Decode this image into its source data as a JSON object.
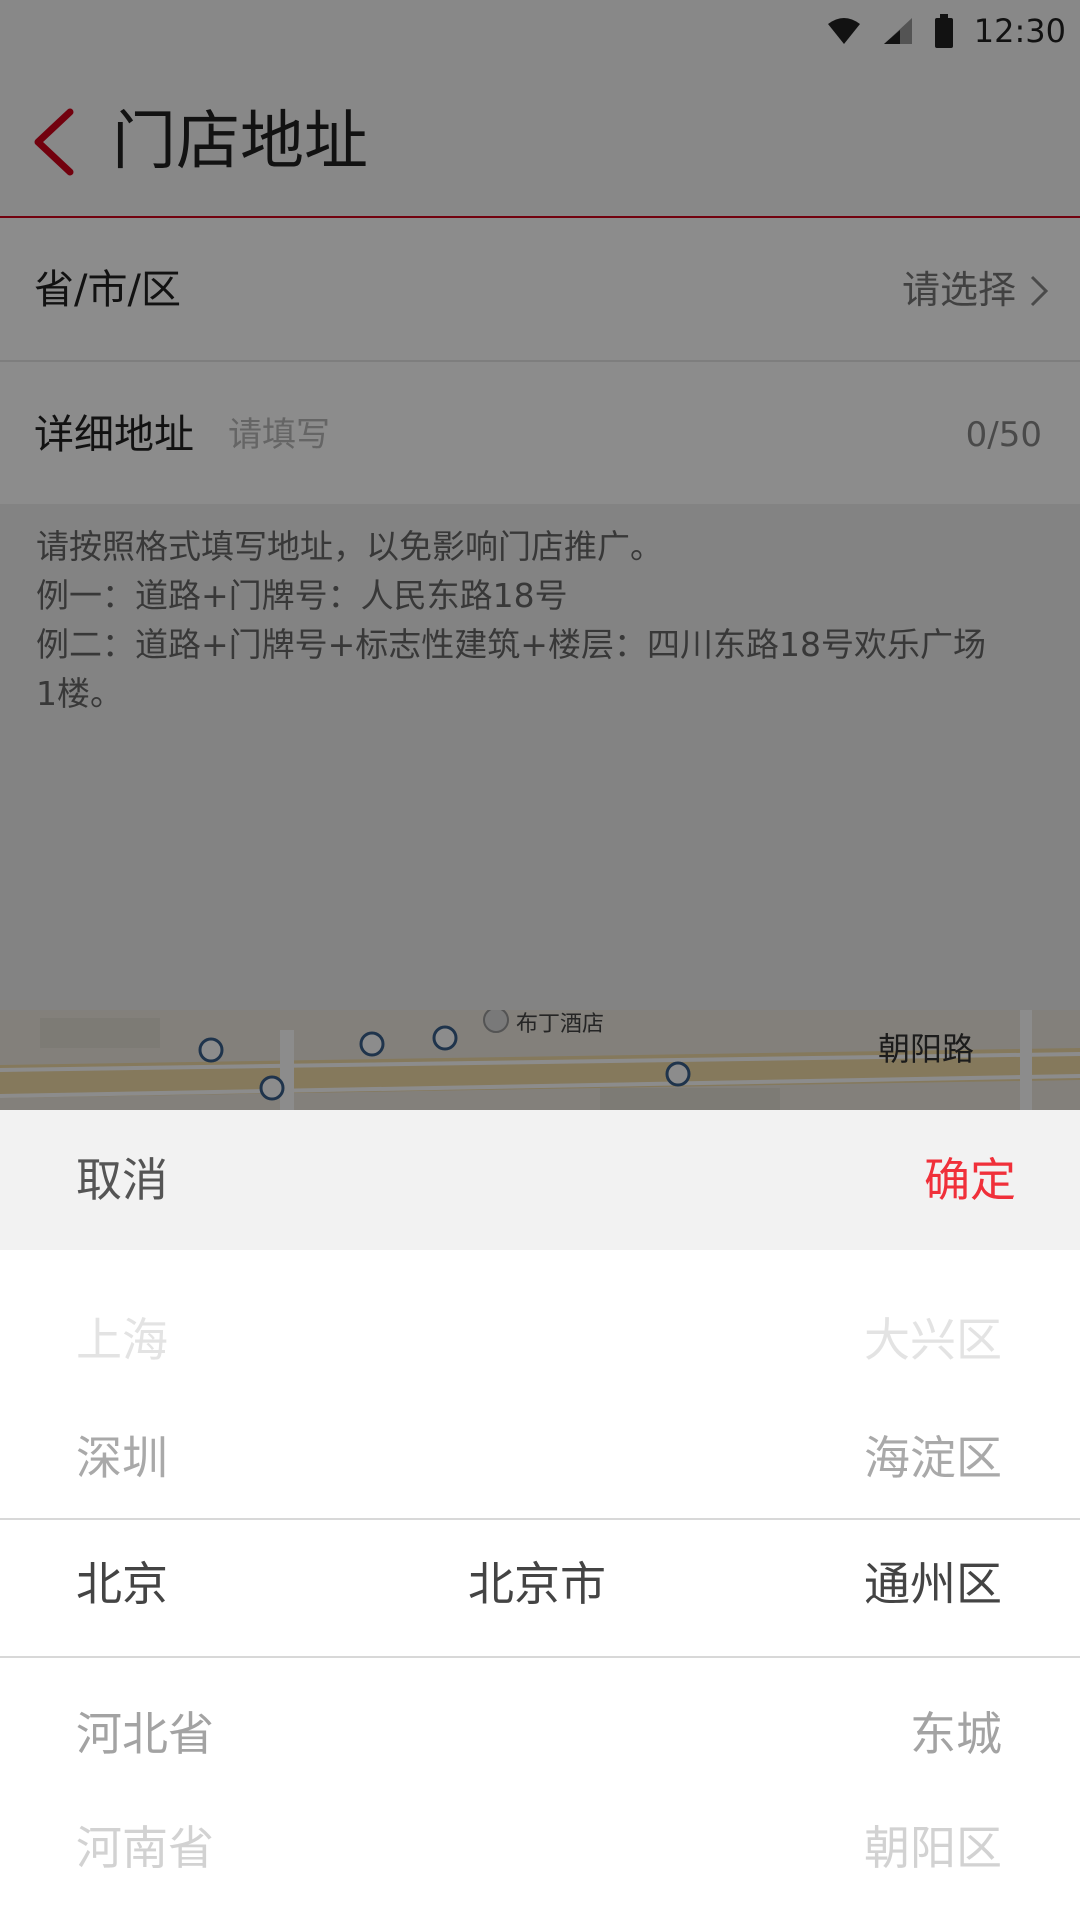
{
  "status_bar": {
    "time": "12:30"
  },
  "nav": {
    "title": "门店地址"
  },
  "form": {
    "region_label": "省/市/区",
    "region_value": "请选择",
    "address_label": "详细地址",
    "address_placeholder": "请填写",
    "address_counter": "0/50"
  },
  "hint": {
    "lines": [
      "请按照格式填写地址，以免影响门店推广。",
      "例一：道路+门牌号：人民东路18号",
      "例二：道路+门牌号+标志性建筑+楼层：四川东路18号欢乐广场",
      "1楼。"
    ]
  },
  "map": {
    "poi_hotel": "布丁酒店",
    "road_label": "朝阳路"
  },
  "picker": {
    "cancel": "取消",
    "confirm": "确定",
    "confirm_color": "#f0303a",
    "rows": [
      {
        "c1": "上海",
        "c2": "",
        "c3": "大兴区"
      },
      {
        "c1": "深圳",
        "c2": "",
        "c3": "海淀区"
      },
      {
        "c1": "北京",
        "c2": "北京市",
        "c3": "通州区"
      },
      {
        "c1": "河北省",
        "c2": "",
        "c3": "东城"
      },
      {
        "c1": "河南省",
        "c2": "",
        "c3": "朝阳区"
      }
    ]
  }
}
